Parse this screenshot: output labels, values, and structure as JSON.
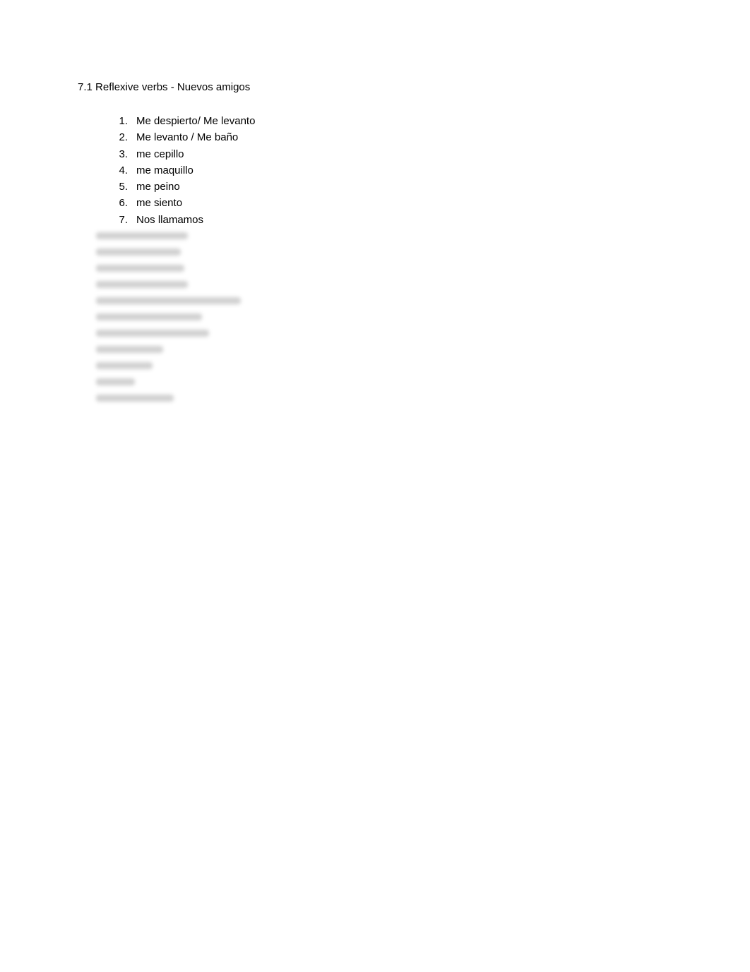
{
  "title": "7.1 Reflexive verbs - Nuevos amigos",
  "items": [
    {
      "number": "1.",
      "text": "Me despierto/ Me levanto"
    },
    {
      "number": "2.",
      "text": "Me levanto / Me baño"
    },
    {
      "number": "3.",
      "text": "me cepillo"
    },
    {
      "number": "4.",
      "text": "me maquillo"
    },
    {
      "number": "5.",
      "text": "me peino"
    },
    {
      "number": "6.",
      "text": "me siento"
    },
    {
      "number": "7.",
      "text": "Nos llamamos"
    }
  ],
  "blurred_widths": [
    130,
    120,
    125,
    130,
    205,
    150,
    160,
    95,
    80,
    55,
    110
  ]
}
